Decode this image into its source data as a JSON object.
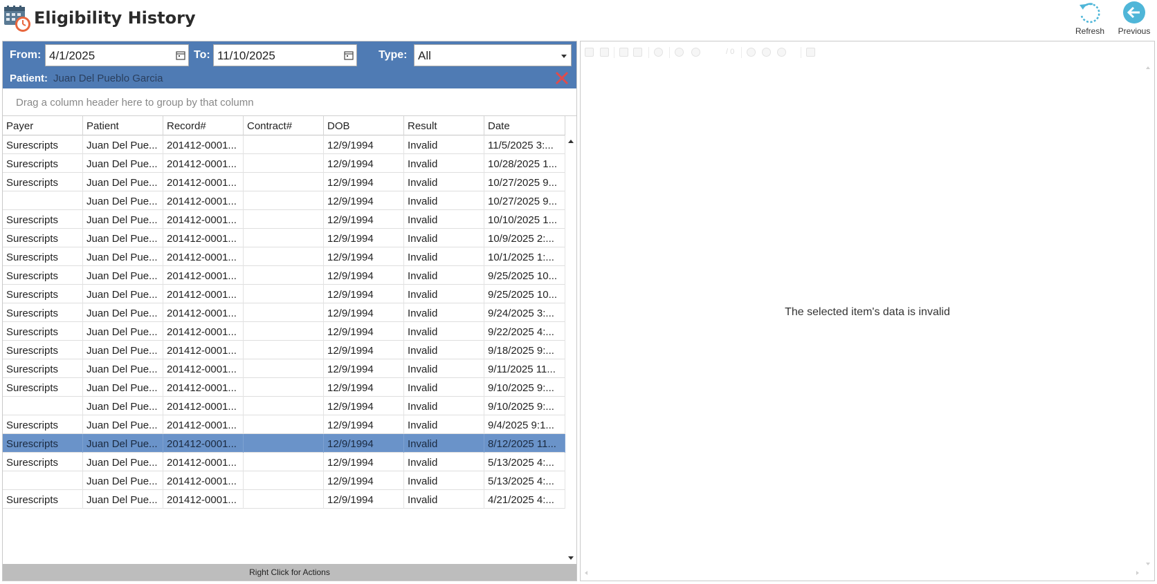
{
  "app": {
    "title": "Eligibility History"
  },
  "header": {
    "refresh_label": "Refresh",
    "previous_label": "Previous",
    "accent": "#4fb6d8"
  },
  "filters": {
    "from_label": "From:",
    "from_value": "4/1/2025",
    "to_label": "To:",
    "to_value": "11/10/2025",
    "type_label": "Type:",
    "type_value": "All",
    "patient_label": "Patient:",
    "patient_value": "Juan Del Pueblo Garcia",
    "bar_color": "#4f7bb4",
    "clear_color": "#e04b4b"
  },
  "grid": {
    "group_hint": "Drag a column header here to group by that column",
    "columns": [
      "Payer",
      "Patient",
      "Record#",
      "Contract#",
      "DOB",
      "Result",
      "Date"
    ],
    "selected_color": "#6a93c9",
    "rows": [
      {
        "payer": "Surescripts",
        "patient": "Juan Del Pue...",
        "record": "201412-0001...",
        "contract": "",
        "dob": "12/9/1994",
        "result": "Invalid",
        "date": "11/5/2025 3:..."
      },
      {
        "payer": "Surescripts",
        "patient": "Juan Del Pue...",
        "record": "201412-0001...",
        "contract": "",
        "dob": "12/9/1994",
        "result": "Invalid",
        "date": "10/28/2025 1..."
      },
      {
        "payer": "Surescripts",
        "patient": "Juan Del Pue...",
        "record": "201412-0001...",
        "contract": "",
        "dob": "12/9/1994",
        "result": "Invalid",
        "date": "10/27/2025 9..."
      },
      {
        "payer": "",
        "patient": "Juan Del Pue...",
        "record": "201412-0001...",
        "contract": "",
        "dob": "12/9/1994",
        "result": "Invalid",
        "date": "10/27/2025 9..."
      },
      {
        "payer": "Surescripts",
        "patient": "Juan Del Pue...",
        "record": "201412-0001...",
        "contract": "",
        "dob": "12/9/1994",
        "result": "Invalid",
        "date": "10/10/2025 1..."
      },
      {
        "payer": "Surescripts",
        "patient": "Juan Del Pue...",
        "record": "201412-0001...",
        "contract": "",
        "dob": "12/9/1994",
        "result": "Invalid",
        "date": "10/9/2025 2:..."
      },
      {
        "payer": "Surescripts",
        "patient": "Juan Del Pue...",
        "record": "201412-0001...",
        "contract": "",
        "dob": "12/9/1994",
        "result": "Invalid",
        "date": "10/1/2025 1:..."
      },
      {
        "payer": "Surescripts",
        "patient": "Juan Del Pue...",
        "record": "201412-0001...",
        "contract": "",
        "dob": "12/9/1994",
        "result": "Invalid",
        "date": "9/25/2025 10..."
      },
      {
        "payer": "Surescripts",
        "patient": "Juan Del Pue...",
        "record": "201412-0001...",
        "contract": "",
        "dob": "12/9/1994",
        "result": "Invalid",
        "date": "9/25/2025 10..."
      },
      {
        "payer": "Surescripts",
        "patient": "Juan Del Pue...",
        "record": "201412-0001...",
        "contract": "",
        "dob": "12/9/1994",
        "result": "Invalid",
        "date": "9/24/2025 3:..."
      },
      {
        "payer": "Surescripts",
        "patient": "Juan Del Pue...",
        "record": "201412-0001...",
        "contract": "",
        "dob": "12/9/1994",
        "result": "Invalid",
        "date": "9/22/2025 4:..."
      },
      {
        "payer": "Surescripts",
        "patient": "Juan Del Pue...",
        "record": "201412-0001...",
        "contract": "",
        "dob": "12/9/1994",
        "result": "Invalid",
        "date": "9/18/2025 9:..."
      },
      {
        "payer": "Surescripts",
        "patient": "Juan Del Pue...",
        "record": "201412-0001...",
        "contract": "",
        "dob": "12/9/1994",
        "result": "Invalid",
        "date": "9/11/2025 11..."
      },
      {
        "payer": "Surescripts",
        "patient": "Juan Del Pue...",
        "record": "201412-0001...",
        "contract": "",
        "dob": "12/9/1994",
        "result": "Invalid",
        "date": "9/10/2025 9:..."
      },
      {
        "payer": "",
        "patient": "Juan Del Pue...",
        "record": "201412-0001...",
        "contract": "",
        "dob": "12/9/1994",
        "result": "Invalid",
        "date": "9/10/2025 9:..."
      },
      {
        "payer": "Surescripts",
        "patient": "Juan Del Pue...",
        "record": "201412-0001...",
        "contract": "",
        "dob": "12/9/1994",
        "result": "Invalid",
        "date": "9/4/2025 9:1..."
      },
      {
        "payer": "Surescripts",
        "patient": "Juan Del Pue...",
        "record": "201412-0001...",
        "contract": "",
        "dob": "12/9/1994",
        "result": "Invalid",
        "date": "8/12/2025 11...",
        "selected": true
      },
      {
        "payer": "Surescripts",
        "patient": "Juan Del Pue...",
        "record": "201412-0001...",
        "contract": "",
        "dob": "12/9/1994",
        "result": "Invalid",
        "date": "5/13/2025 4:..."
      },
      {
        "payer": "",
        "patient": "Juan Del Pue...",
        "record": "201412-0001...",
        "contract": "",
        "dob": "12/9/1994",
        "result": "Invalid",
        "date": "5/13/2025 4:..."
      },
      {
        "payer": "Surescripts",
        "patient": "Juan Del Pue...",
        "record": "201412-0001...",
        "contract": "",
        "dob": "12/9/1994",
        "result": "Invalid",
        "date": "4/21/2025 4:..."
      }
    ]
  },
  "status_bar": {
    "text": "Right Click for Actions"
  },
  "viewer": {
    "message": "The selected item's data is invalid",
    "page_count": "/ 0"
  }
}
